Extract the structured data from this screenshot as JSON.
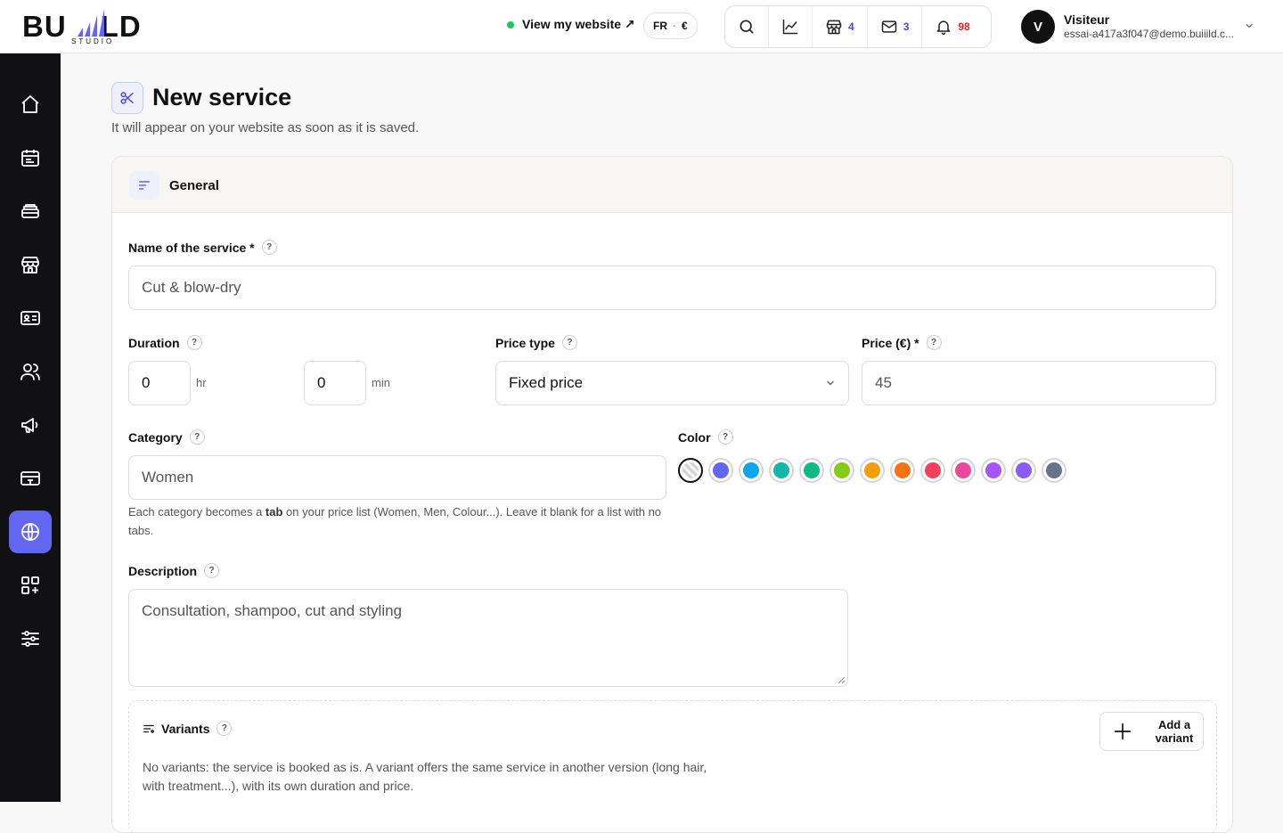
{
  "brand": {
    "word_left": "BU",
    "word_right": "LD",
    "studio": "STUDIO"
  },
  "header": {
    "view_site": "View my website ↗",
    "lang": "FR",
    "currency": "€",
    "shop_count": "4",
    "mail_count": "3",
    "notif_count": "98",
    "user_initial": "V",
    "user_name": "Visiteur",
    "user_email": "essai-a417a3f047@demo.buiiild.c..."
  },
  "page": {
    "title": "New service",
    "subtitle": "It will appear on your website as soon as it is saved."
  },
  "section": {
    "title": "General"
  },
  "form": {
    "name_label": "Name of the service *",
    "name_placeholder": "Cut & blow-dry",
    "duration_label": "Duration",
    "hours_value": "0",
    "hours_unit": "hr",
    "minutes_value": "0",
    "minutes_unit": "min",
    "price_type_label": "Price type",
    "price_type_value": "Fixed price",
    "price_label": "Price (€) *",
    "price_placeholder": "45",
    "category_label": "Category",
    "category_placeholder": "Women",
    "category_hint_pre": "Each category becomes a ",
    "category_hint_bold": "tab",
    "category_hint_post": " on your price list (Women, Men, Colour...). Leave it blank for a list with no tabs.",
    "color_label": "Color",
    "colors": [
      "none",
      "#6366f1",
      "#0ea5e9",
      "#14b8a6",
      "#10b981",
      "#84cc16",
      "#f59e0b",
      "#f97316",
      "#f43f5e",
      "#ec4899",
      "#a855f7",
      "#8b5cf6",
      "#64748b"
    ],
    "description_label": "Description",
    "description_placeholder": "Consultation, shampoo, cut and styling",
    "variants_label": "Variants",
    "add_variant": "Add a variant",
    "variants_desc": "No variants: the service is booked as is. A variant offers the same service in another version (long hair, with treatment...), with its own duration and price."
  },
  "help_glyph": "?",
  "accent": "#6366f1"
}
